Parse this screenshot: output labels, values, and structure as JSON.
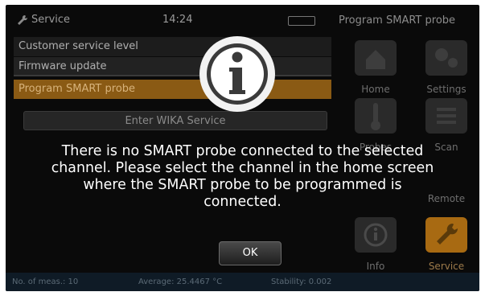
{
  "background": {
    "title": "Service",
    "time": "14:24",
    "menu": [
      "Customer service level",
      "Firmware update",
      "Program SMART probe"
    ],
    "enter_button": "Enter WIKA Service",
    "right_title": "Program SMART probe",
    "tiles": {
      "home": "Home",
      "settings": "Settings",
      "probes": "Probes",
      "scan": "Scan",
      "remote": "Remote",
      "info": "Info",
      "service": "Service"
    },
    "status": {
      "meas": "No. of meas.: 10",
      "average": "Average: 25.4467 °C",
      "stability": "Stability: 0.002"
    }
  },
  "dialog": {
    "icon": "info-icon",
    "message": "There is no SMART probe connected to the selected\nchannel. Please select the channel in the home screen\nwhere the SMART probe to be programmed is\nconnected.",
    "ok_label": "OK"
  }
}
